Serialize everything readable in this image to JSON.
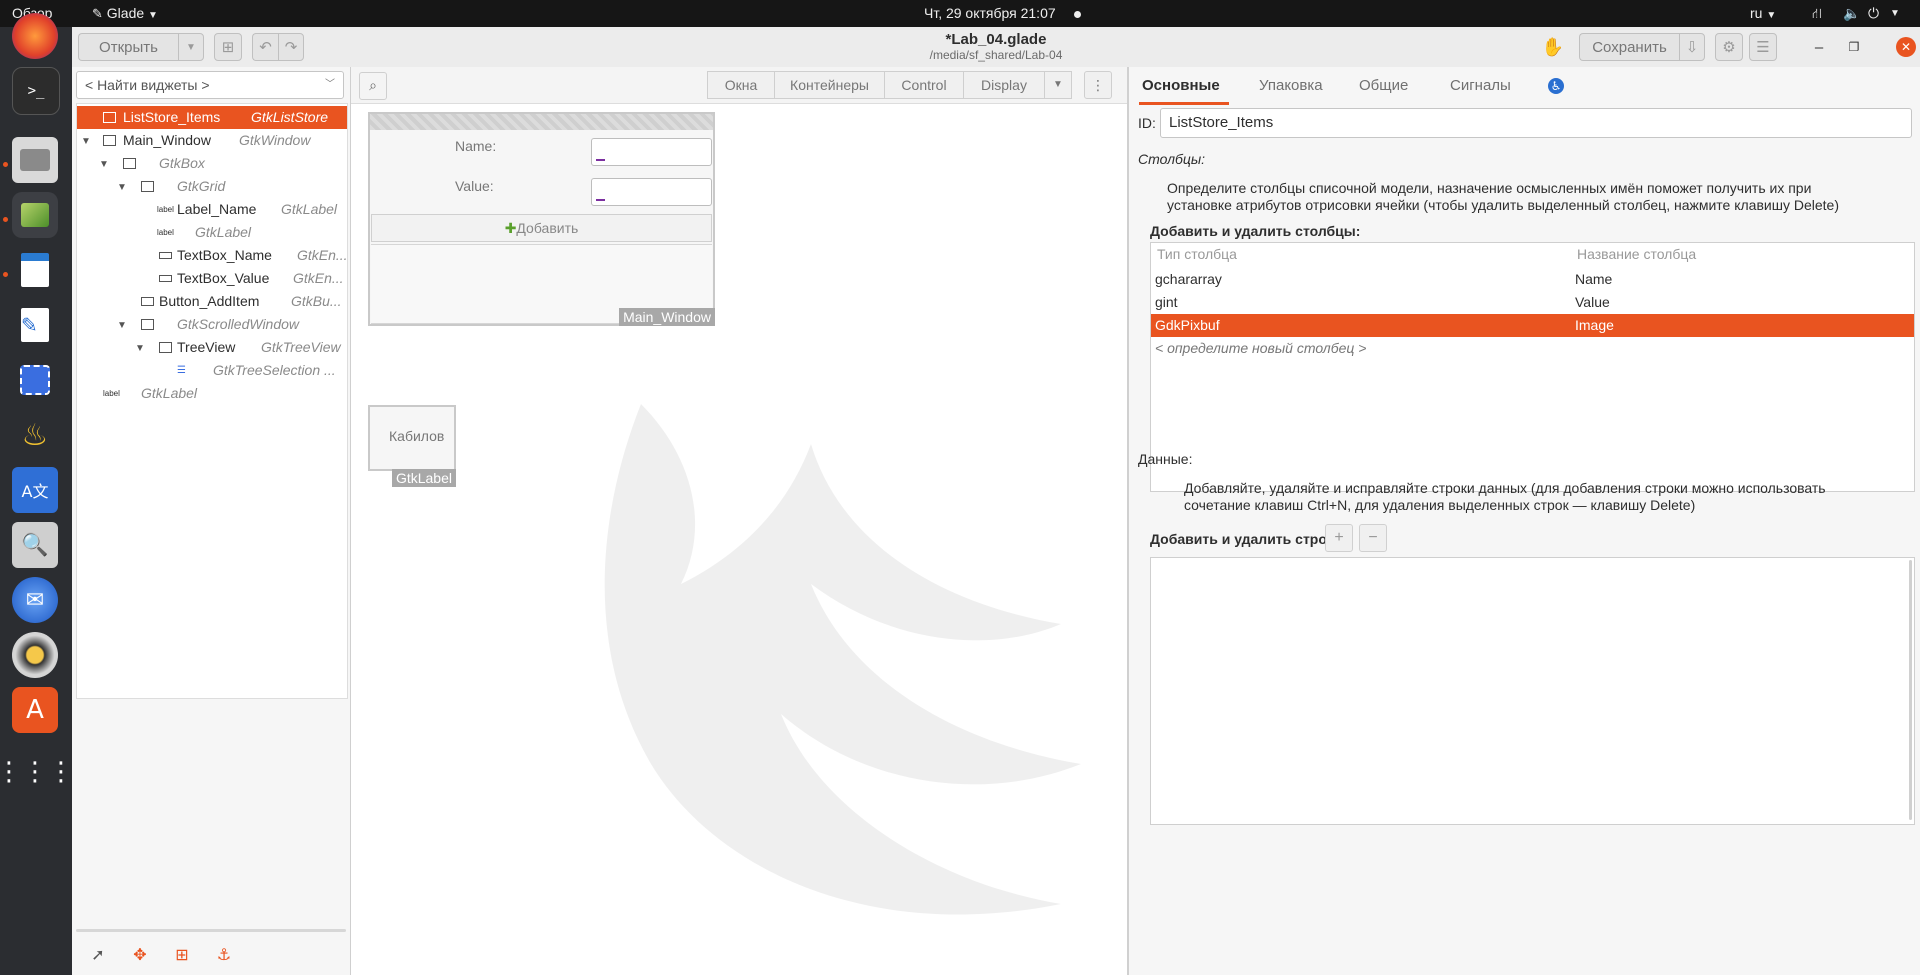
{
  "topbar": {
    "activities": "Обзор",
    "app_menu": "Glade",
    "datetime": "Чт, 29 октября  21:07",
    "language": "ru"
  },
  "dock": {
    "items": [
      "firefox-icon",
      "terminal-icon",
      "files-icon",
      "glade-icon",
      "impress-icon",
      "text-editor-icon",
      "screenshot-icon",
      "teapot-icon",
      "translate-icon",
      "search-icon",
      "thunderbird-icon",
      "rhythmbox-icon",
      "app-center-icon",
      "apps-grid-icon"
    ]
  },
  "header": {
    "open_label": "Открыть",
    "title": "*Lab_04.glade",
    "subtitle": "/media/sf_shared/Lab-04",
    "save_label": "Сохранить"
  },
  "left": {
    "search_placeholder": "< Найти виджеты >",
    "tree": [
      {
        "name": "ListStore_Items",
        "type": "GtkListStore"
      },
      {
        "name": "Main_Window",
        "type": "GtkWindow"
      },
      {
        "name": "GtkBox",
        "type": ""
      },
      {
        "name": "GtkGrid",
        "type": ""
      },
      {
        "name": "Label_Name",
        "type": "GtkLabel"
      },
      {
        "name": "GtkLabel",
        "type": ""
      },
      {
        "name": "TextBox_Name",
        "type": "GtkEn..."
      },
      {
        "name": "TextBox_Value",
        "type": "GtkEn..."
      },
      {
        "name": "Button_AddItem",
        "type": "GtkBu..."
      },
      {
        "name": "GtkScrolledWindow",
        "type": ""
      },
      {
        "name": "TreeView",
        "type": "GtkTreeView"
      },
      {
        "name": "GtkTreeSelection ...",
        "type": ""
      },
      {
        "name": "GtkLabel",
        "type": ""
      }
    ],
    "icon_label": "label"
  },
  "palette": {
    "groups": [
      "Окна",
      "Контейнеры",
      "Control",
      "Display"
    ]
  },
  "design": {
    "name_label": "Name:",
    "value_label": "Value:",
    "add_button": "Добавить",
    "window_tag": "Main_Window",
    "label_text": "Кабилов",
    "label_tag": "GtkLabel"
  },
  "right": {
    "tabs": [
      "Основные",
      "Упаковка",
      "Общие",
      "Сигналы"
    ],
    "id_label": "ID:",
    "id_value": "ListStore_Items",
    "columns_heading": "Столбцы:",
    "columns_desc_1": "Определите столбцы списочной модели, назначение осмысленных имён поможет получить их при",
    "columns_desc_2": "установке атрибутов отрисовки ячейки (чтобы удалить выделенный столбец, нажмите клавишу Delete)",
    "add_remove_columns": "Добавить и удалить столбцы:",
    "col_header_type": "Тип столбца",
    "col_header_name": "Название столбца",
    "columns": [
      {
        "type": "gchararray",
        "name": "Name"
      },
      {
        "type": "gint",
        "name": "Value"
      },
      {
        "type": "GdkPixbuf",
        "name": "Image"
      }
    ],
    "new_column_hint": "< определите новый столбец >",
    "data_heading": "Данные:",
    "data_desc_1": "Добавляйте, удаляйте и исправляйте строки данных (для добавления строки можно использовать",
    "data_desc_2": "сочетание клавиш Ctrl+N, для удаления выделенных строк — клавишу Delete)",
    "add_remove_rows": "Добавить и удалить строки:",
    "plus": "+",
    "minus": "−"
  },
  "colors": {
    "accent": "#e95420",
    "dock_bg": "#2b2d31",
    "topbar_bg": "#161616"
  }
}
